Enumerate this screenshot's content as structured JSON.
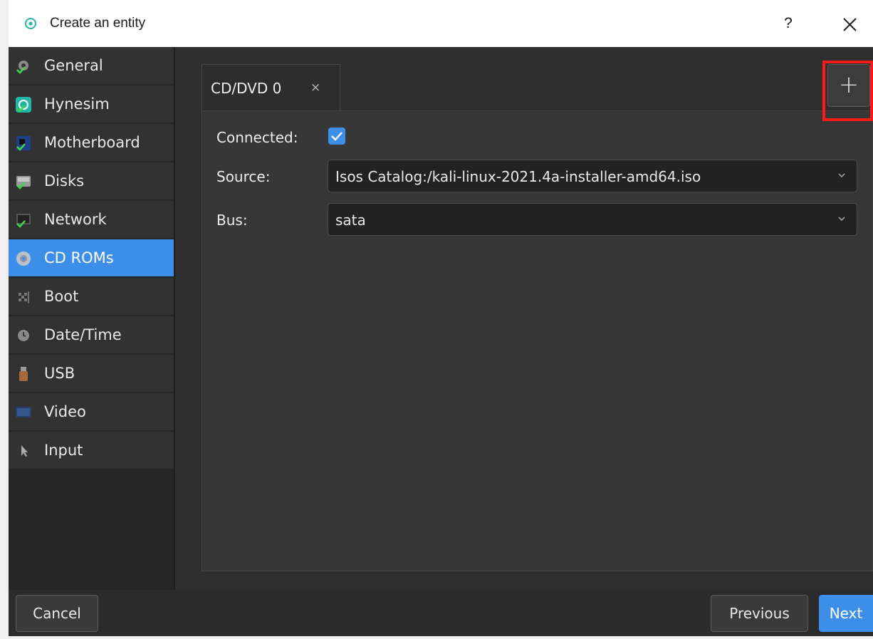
{
  "window": {
    "title": "Create an entity",
    "help_label": "?"
  },
  "sidebar": {
    "items": [
      {
        "label": "General"
      },
      {
        "label": "Hynesim"
      },
      {
        "label": "Motherboard"
      },
      {
        "label": "Disks"
      },
      {
        "label": "Network"
      },
      {
        "label": "CD ROMs"
      },
      {
        "label": "Boot"
      },
      {
        "label": "Date/Time"
      },
      {
        "label": "USB"
      },
      {
        "label": "Video"
      },
      {
        "label": "Input"
      }
    ],
    "active_item": "CD ROMs"
  },
  "tabs": {
    "items": [
      {
        "label": "CD/DVD 0",
        "close_label": "×"
      }
    ],
    "add_label": "+"
  },
  "form": {
    "connected_label": "Connected:",
    "connected_checked": true,
    "source_label": "Source:",
    "source_value": "Isos Catalog:/kali-linux-2021.4a-installer-amd64.iso",
    "bus_label": "Bus:",
    "bus_value": "sata"
  },
  "footer": {
    "cancel_label": "Cancel",
    "previous_label": "Previous",
    "next_label": "Next"
  },
  "colors": {
    "accent": "#3d8ee9",
    "highlight": "#ff1a1a",
    "background": "#2f2f2f"
  }
}
